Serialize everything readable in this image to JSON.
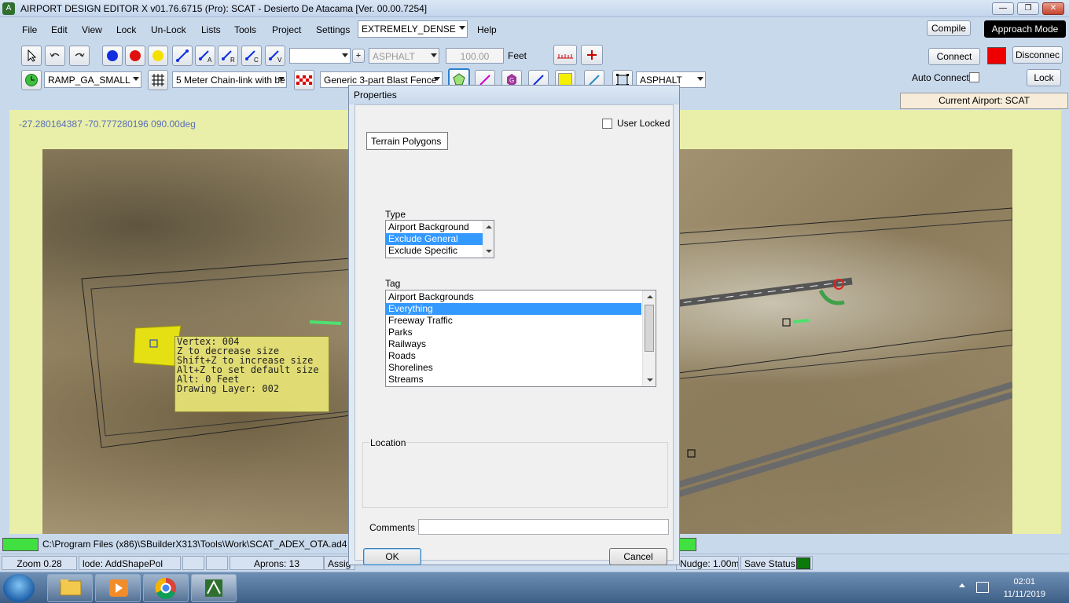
{
  "window": {
    "title": "AIRPORT DESIGN EDITOR X  v01.76.6715  (Pro): SCAT - Desierto De Atacama [Ver. 00.00.7254]",
    "minimize": "—",
    "maximize": "❐",
    "close": "✕"
  },
  "menu": {
    "items": [
      "File",
      "Edit",
      "View",
      "Lock",
      "Un-Lock",
      "Lists",
      "Tools",
      "Project",
      "Settings",
      "Help"
    ],
    "density": "EXTREMELY_DENSE"
  },
  "toolbar": {
    "compile": "Compile",
    "approach_mode": "Approach Mode",
    "connect": "Connect",
    "disconnect": "Disconnec",
    "auto_connect": "Auto Connect",
    "lock": "Lock",
    "current_airport": "Current Airport: SCAT",
    "surface_combo": "ASPHALT",
    "value_box": "100.00",
    "units": "Feet",
    "ramp_combo": "RAMP_GA_SMALL",
    "fence_combo": "5 Meter Chain-link with be",
    "blast_fence_combo": "Generic 3-part Blast Fence",
    "surface_combo2": "ASPHALT",
    "colors": {
      "blue": "#1030e0",
      "red": "#e01010",
      "yellow": "#f4e000",
      "connection_status": "#ee0000"
    },
    "icons": [
      "select-arrow-icon",
      "undo-icon",
      "redo-icon",
      "blue-dot-icon",
      "red-dot-icon",
      "yellow-dot-icon",
      "link-icon",
      "link-a-icon",
      "link-r-icon",
      "link-c-icon",
      "link-v-icon",
      "ruler-icon",
      "plus-icon",
      "clock-icon",
      "grid-icon",
      "checker-icon",
      "polygon-icon",
      "pen-icon",
      "gear-icon",
      "line-icon",
      "yellow-square-icon",
      "line2-icon",
      "frame-icon"
    ]
  },
  "map": {
    "coordinates": "-27.280164387    -70.777280196 090.00deg",
    "tooltip": [
      "Vertex: 004",
      "Z to decrease size",
      "Shift+Z to increase size",
      "Alt+Z to set default size",
      "",
      "Alt: 0 Feet",
      "",
      "Drawing Layer: 002"
    ]
  },
  "dialog": {
    "title": "Properties",
    "user_locked": "User Locked",
    "object_name": "Terrain Polygons",
    "type_label": "Type",
    "type_options": [
      "Airport Background",
      "Exclude General",
      "Exclude Specific"
    ],
    "type_selected": "Exclude General",
    "tag_label": "Tag",
    "tag_options": [
      "Airport Backgrounds",
      "Everything",
      "Freeway Traffic",
      "Parks",
      "Railways",
      "Roads",
      "Shorelines",
      "Streams"
    ],
    "tag_selected": "Everything",
    "location_label": "Location",
    "comments_label": "Comments",
    "comments_value": "",
    "ok": "OK",
    "cancel": "Cancel"
  },
  "status": {
    "path": "C:\\Program Files (x86)\\SBuilderX313\\Tools\\Work\\SCAT_ADEX_OTA.ad4",
    "zoom": "Zoom 0.28",
    "mode": "lode: AddShapePol",
    "aprons": "Aprons: 13",
    "assign": "Assig",
    "nudge": "Nudge: 1.00m",
    "save_status": "Save Status:",
    "save_color": "#0a7a0a"
  },
  "taskbar": {
    "time": "02:01",
    "date": "11/11/2019"
  }
}
